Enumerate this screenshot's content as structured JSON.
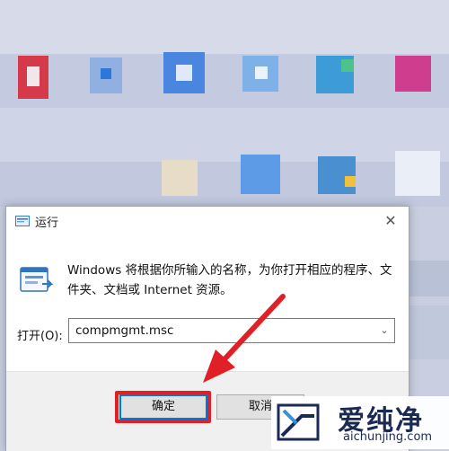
{
  "dialog": {
    "title": "运行",
    "close_glyph": "✕",
    "description": "Windows 将根据你所输入的名称，为你打开相应的程序、文件夹、文档或 Internet 资源。",
    "open_label": "打开(O):",
    "command_value": "compmgmt.msc",
    "dropdown_glyph": "⌄",
    "ok_label": "确定",
    "cancel_label": "取消"
  },
  "annotation": {
    "highlight_color": "#e11f26",
    "target": "ok-button"
  },
  "watermark": {
    "cn": "爱纯净",
    "en": "aichunjing.com"
  },
  "colors": {
    "accent": "#0078d7",
    "footer_bg": "#f0f0f0"
  }
}
